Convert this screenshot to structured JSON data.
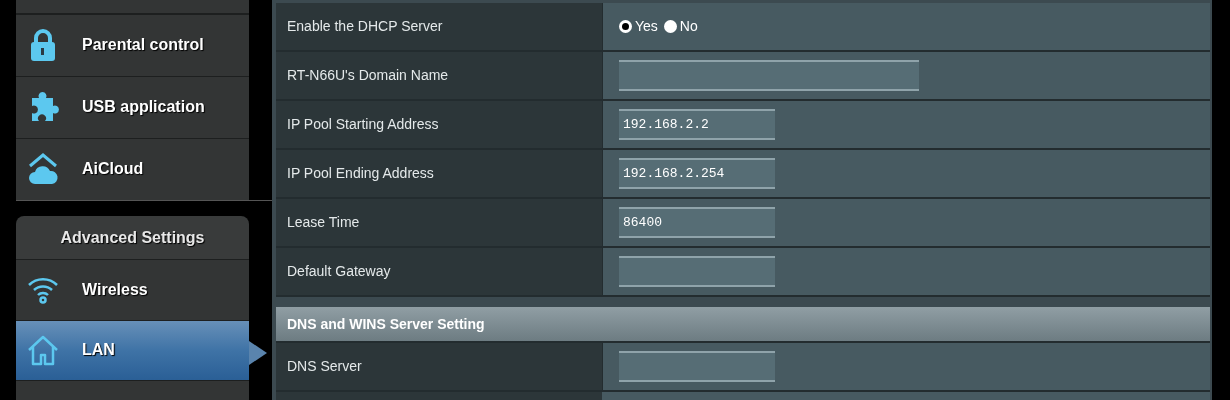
{
  "sidebar": {
    "general_items": [
      {
        "label": "Parental control",
        "selected": false
      },
      {
        "label": "USB application",
        "selected": false
      },
      {
        "label": "AiCloud",
        "selected": false
      }
    ],
    "advanced_header": "Advanced Settings",
    "advanced_items": [
      {
        "label": "Wireless",
        "selected": false
      },
      {
        "label": "LAN",
        "selected": true
      }
    ]
  },
  "dhcp_rows": [
    {
      "label": "Enable the DHCP Server",
      "kind": "radio",
      "options": [
        {
          "label": "Yes",
          "selected": true
        },
        {
          "label": "No",
          "selected": false
        }
      ]
    },
    {
      "label": "RT-N66U's Domain Name",
      "kind": "wide_text"
    },
    {
      "label": "IP Pool Starting Address",
      "kind": "text",
      "value": "192.168.2.2"
    },
    {
      "label": "IP Pool Ending Address",
      "kind": "text",
      "value": "192.168.2.254"
    },
    {
      "label": "Lease Time",
      "kind": "text",
      "value": "86400"
    },
    {
      "label": "Default Gateway",
      "kind": "text"
    }
  ],
  "dns_section": {
    "title": "DNS and WINS Server Setting",
    "rows": [
      {
        "label": "DNS Server",
        "kind": "text"
      }
    ]
  }
}
